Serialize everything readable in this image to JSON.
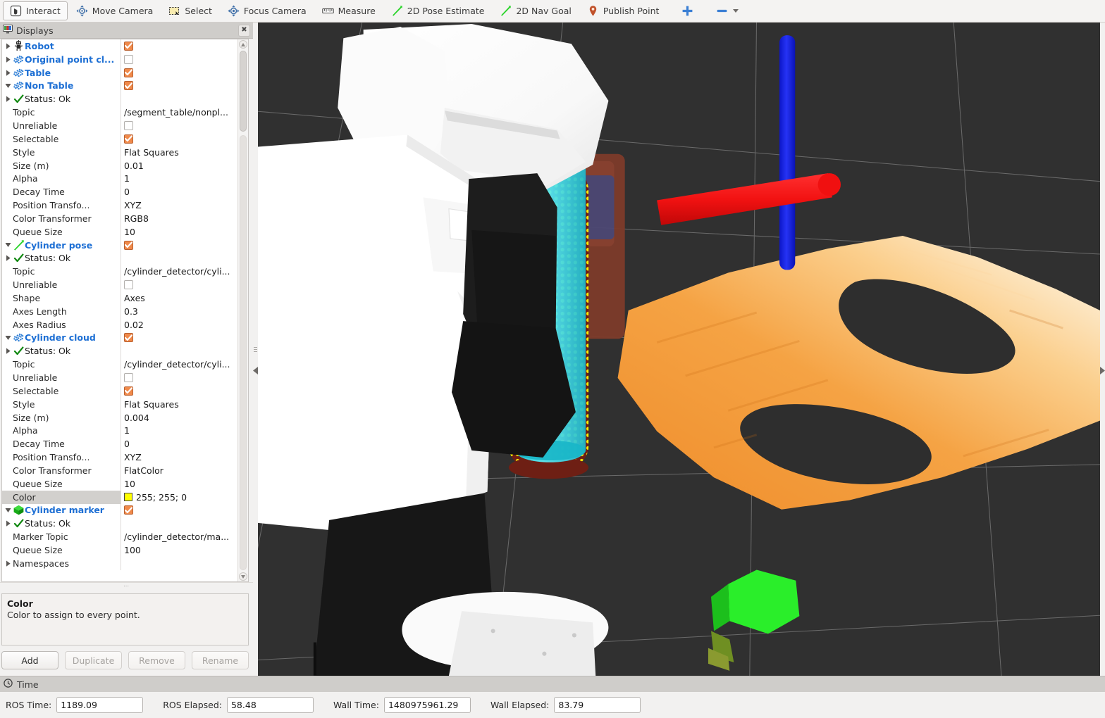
{
  "toolbar": {
    "buttons": [
      {
        "label": "Interact",
        "icon": "hand-cursor-icon",
        "active": true
      },
      {
        "label": "Move Camera",
        "icon": "move-camera-icon",
        "active": false
      },
      {
        "label": "Select",
        "icon": "select-rectangle-icon",
        "active": false
      },
      {
        "label": "Focus Camera",
        "icon": "focus-camera-icon",
        "active": false
      },
      {
        "label": "Measure",
        "icon": "measure-ruler-icon",
        "active": false
      },
      {
        "label": "2D Pose Estimate",
        "icon": "pose-arrow-icon",
        "active": false
      },
      {
        "label": "2D Nav Goal",
        "icon": "nav-goal-arrow-icon",
        "active": false
      },
      {
        "label": "Publish Point",
        "icon": "map-pin-icon",
        "active": false
      }
    ],
    "add_tool_icon": "plus-icon",
    "remove_tool_icon": "minus-icon",
    "remove_tool_dropdown_icon": "chevron-down-icon"
  },
  "displays_panel": {
    "title": "Displays",
    "close_icon": "close-icon",
    "rows": [
      {
        "indent": 1,
        "arrow": "right",
        "icon": "robot-icon",
        "label": "Robot",
        "kind": "display",
        "value_type": "checkbox",
        "checked": true
      },
      {
        "indent": 1,
        "arrow": "right",
        "icon": "pointcloud-icon",
        "label": "Original point cl...",
        "kind": "display",
        "value_type": "checkbox",
        "checked": false
      },
      {
        "indent": 1,
        "arrow": "right",
        "icon": "pointcloud-icon",
        "label": "Table",
        "kind": "display",
        "value_type": "checkbox",
        "checked": true
      },
      {
        "indent": 1,
        "arrow": "down",
        "icon": "pointcloud-icon",
        "label": "Non Table",
        "kind": "display",
        "value_type": "checkbox",
        "checked": true
      },
      {
        "indent": 2,
        "arrow": "right",
        "icon": "check-icon",
        "label": "Status: Ok",
        "kind": "status",
        "value_type": "none"
      },
      {
        "indent": 3,
        "arrow": "none",
        "icon": "none",
        "label": "Topic",
        "kind": "prop",
        "value_type": "text",
        "value": "/segment_table/nonpl..."
      },
      {
        "indent": 3,
        "arrow": "none",
        "icon": "none",
        "label": "Unreliable",
        "kind": "prop",
        "value_type": "checkbox",
        "checked": false
      },
      {
        "indent": 3,
        "arrow": "none",
        "icon": "none",
        "label": "Selectable",
        "kind": "prop",
        "value_type": "checkbox",
        "checked": true
      },
      {
        "indent": 3,
        "arrow": "none",
        "icon": "none",
        "label": "Style",
        "kind": "prop",
        "value_type": "text",
        "value": "Flat Squares"
      },
      {
        "indent": 3,
        "arrow": "none",
        "icon": "none",
        "label": "Size (m)",
        "kind": "prop",
        "value_type": "text",
        "value": "0.01"
      },
      {
        "indent": 3,
        "arrow": "none",
        "icon": "none",
        "label": "Alpha",
        "kind": "prop",
        "value_type": "text",
        "value": "1"
      },
      {
        "indent": 3,
        "arrow": "none",
        "icon": "none",
        "label": "Decay Time",
        "kind": "prop",
        "value_type": "text",
        "value": "0"
      },
      {
        "indent": 3,
        "arrow": "none",
        "icon": "none",
        "label": "Position Transfo...",
        "kind": "prop",
        "value_type": "text",
        "value": "XYZ"
      },
      {
        "indent": 3,
        "arrow": "none",
        "icon": "none",
        "label": "Color Transformer",
        "kind": "prop",
        "value_type": "text",
        "value": "RGB8"
      },
      {
        "indent": 3,
        "arrow": "none",
        "icon": "none",
        "label": "Queue Size",
        "kind": "prop",
        "value_type": "text",
        "value": "10"
      },
      {
        "indent": 1,
        "arrow": "down",
        "icon": "pose-arrow-icon",
        "label": "Cylinder pose",
        "kind": "display",
        "value_type": "checkbox",
        "checked": true
      },
      {
        "indent": 2,
        "arrow": "right",
        "icon": "check-icon",
        "label": "Status: Ok",
        "kind": "status",
        "value_type": "none"
      },
      {
        "indent": 3,
        "arrow": "none",
        "icon": "none",
        "label": "Topic",
        "kind": "prop",
        "value_type": "text",
        "value": "/cylinder_detector/cyli..."
      },
      {
        "indent": 3,
        "arrow": "none",
        "icon": "none",
        "label": "Unreliable",
        "kind": "prop",
        "value_type": "checkbox",
        "checked": false
      },
      {
        "indent": 3,
        "arrow": "none",
        "icon": "none",
        "label": "Shape",
        "kind": "prop",
        "value_type": "text",
        "value": "Axes"
      },
      {
        "indent": 3,
        "arrow": "none",
        "icon": "none",
        "label": "Axes Length",
        "kind": "prop",
        "value_type": "text",
        "value": "0.3"
      },
      {
        "indent": 3,
        "arrow": "none",
        "icon": "none",
        "label": "Axes Radius",
        "kind": "prop",
        "value_type": "text",
        "value": "0.02"
      },
      {
        "indent": 1,
        "arrow": "down",
        "icon": "pointcloud-icon",
        "label": "Cylinder cloud",
        "kind": "display",
        "value_type": "checkbox",
        "checked": true
      },
      {
        "indent": 2,
        "arrow": "right",
        "icon": "check-icon",
        "label": "Status: Ok",
        "kind": "status",
        "value_type": "none"
      },
      {
        "indent": 3,
        "arrow": "none",
        "icon": "none",
        "label": "Topic",
        "kind": "prop",
        "value_type": "text",
        "value": "/cylinder_detector/cyli..."
      },
      {
        "indent": 3,
        "arrow": "none",
        "icon": "none",
        "label": "Unreliable",
        "kind": "prop",
        "value_type": "checkbox",
        "checked": false
      },
      {
        "indent": 3,
        "arrow": "none",
        "icon": "none",
        "label": "Selectable",
        "kind": "prop",
        "value_type": "checkbox",
        "checked": true
      },
      {
        "indent": 3,
        "arrow": "none",
        "icon": "none",
        "label": "Style",
        "kind": "prop",
        "value_type": "text",
        "value": "Flat Squares"
      },
      {
        "indent": 3,
        "arrow": "none",
        "icon": "none",
        "label": "Size (m)",
        "kind": "prop",
        "value_type": "text",
        "value": "0.004"
      },
      {
        "indent": 3,
        "arrow": "none",
        "icon": "none",
        "label": "Alpha",
        "kind": "prop",
        "value_type": "text",
        "value": "1"
      },
      {
        "indent": 3,
        "arrow": "none",
        "icon": "none",
        "label": "Decay Time",
        "kind": "prop",
        "value_type": "text",
        "value": "0"
      },
      {
        "indent": 3,
        "arrow": "none",
        "icon": "none",
        "label": "Position Transfo...",
        "kind": "prop",
        "value_type": "text",
        "value": "XYZ"
      },
      {
        "indent": 3,
        "arrow": "none",
        "icon": "none",
        "label": "Color Transformer",
        "kind": "prop",
        "value_type": "text",
        "value": "FlatColor"
      },
      {
        "indent": 3,
        "arrow": "none",
        "icon": "none",
        "label": "Queue Size",
        "kind": "prop",
        "value_type": "text",
        "value": "10"
      },
      {
        "indent": 3,
        "arrow": "none",
        "icon": "none",
        "label": "Color",
        "kind": "prop",
        "value_type": "color",
        "value": "255; 255; 0",
        "swatch": "#ffff00",
        "selected": true
      },
      {
        "indent": 1,
        "arrow": "down",
        "icon": "marker-cube-icon",
        "label": "Cylinder marker",
        "kind": "display",
        "value_type": "checkbox",
        "checked": true
      },
      {
        "indent": 2,
        "arrow": "right",
        "icon": "check-icon",
        "label": "Status: Ok",
        "kind": "status",
        "value_type": "none"
      },
      {
        "indent": 3,
        "arrow": "none",
        "icon": "none",
        "label": "Marker Topic",
        "kind": "prop",
        "value_type": "text",
        "value": "/cylinder_detector/ma..."
      },
      {
        "indent": 3,
        "arrow": "none",
        "icon": "none",
        "label": "Queue Size",
        "kind": "prop",
        "value_type": "text",
        "value": "100"
      },
      {
        "indent": 2,
        "arrow": "right",
        "icon": "none",
        "label": "Namespaces",
        "kind": "prop",
        "value_type": "none"
      }
    ],
    "description": {
      "title": "Color",
      "text": "Color to assign to every point."
    },
    "buttons": [
      {
        "label": "Add",
        "enabled": true
      },
      {
        "label": "Duplicate",
        "enabled": false
      },
      {
        "label": "Remove",
        "enabled": false
      },
      {
        "label": "Rename",
        "enabled": false
      }
    ]
  },
  "view3d": {
    "background_color": "#303030",
    "grid_color": "#9a9a9a",
    "robot_color": "#ffffff",
    "table_cloud_color": "#f29a3c",
    "cylinder_marker_color": "#33e0ee",
    "cylinder_cloud_color": "#ffff00",
    "axis_x_color": "#ff1a1a",
    "axis_y_color": "#22ee22",
    "axis_z_color": "#1122ee",
    "object_green_color": "#22ee22",
    "collapse_left_icon": "triangle-left-icon",
    "collapse_right_icon": "triangle-right-icon"
  },
  "time_panel": {
    "title": "Time",
    "clock_icon": "clock-icon",
    "fields": [
      {
        "label": "ROS Time:",
        "value": "1189.09"
      },
      {
        "label": "ROS Elapsed:",
        "value": "58.48"
      },
      {
        "label": "Wall Time:",
        "value": "1480975961.29"
      },
      {
        "label": "Wall Elapsed:",
        "value": "83.79"
      }
    ]
  }
}
